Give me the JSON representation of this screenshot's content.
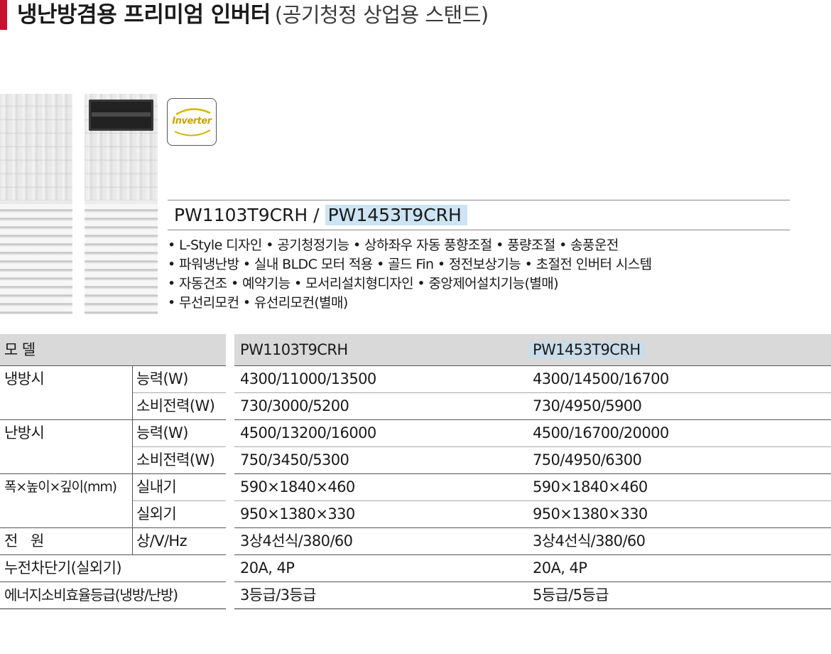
{
  "title": {
    "main": "냉난방겸용 프리미엄 인버터",
    "sub": "(공기청정 상업용 스탠드)"
  },
  "badge": {
    "label": "Inverter"
  },
  "models": {
    "model_a": "PW1103T9CRH",
    "separator": " / ",
    "model_b": "PW1453T9CRH"
  },
  "features": [
    "• L-Style 디자인 • 공기청정기능 • 상하좌우 자동 풍향조절 • 풍량조절 • 송풍운전",
    "• 파워냉난방 • 실내 BLDC 모터 적용 • 골드 Fin • 정전보상기능 • 초절전 인버터 시스템",
    "• 자동건조 • 예약기능 • 모서리설치형디자인 • 중앙제어설치기능(별매)",
    "• 무선리모컨 • 유선리모컨(별매)"
  ],
  "spec_table": {
    "header": {
      "label": "모 델",
      "model_a": "PW1103T9CRH",
      "model_b": "PW1453T9CRH"
    },
    "rows": [
      {
        "group": "냉방시",
        "item": "능력(W)",
        "a": "4300/11000/13500",
        "b": "4300/14500/16700"
      },
      {
        "group": "",
        "item": "소비전력(W)",
        "a": "730/3000/5200",
        "b": "730/4950/5900"
      },
      {
        "group": "난방시",
        "item": "능력(W)",
        "a": "4500/13200/16000",
        "b": "4500/16700/20000"
      },
      {
        "group": "",
        "item": "소비전력(W)",
        "a": "750/3450/5300",
        "b": "750/4950/6300"
      },
      {
        "group": "폭×높이×깊이(mm)",
        "item": "실내기",
        "a": "590×1840×460",
        "b": "590×1840×460"
      },
      {
        "group": "",
        "item": "실외기",
        "a": "950×1380×330",
        "b": "950×1380×330"
      },
      {
        "group": "전   원",
        "item": "상/V/Hz",
        "a": "3상4선식/380/60",
        "b": "3상4선식/380/60"
      },
      {
        "group": "누전차단기(실외기)",
        "item": "",
        "a": "20A, 4P",
        "b": "20A, 4P"
      },
      {
        "group": "에너지소비효율등급(냉방/난방)",
        "item": "",
        "a": "3등급/3등급",
        "b": "5등급/5등급"
      }
    ]
  },
  "colors": {
    "title_accent": "#c8102e",
    "model_highlight": "#cce4f3",
    "table_header_bg": "#d9d9d9",
    "badge_text": "#c9a300"
  }
}
